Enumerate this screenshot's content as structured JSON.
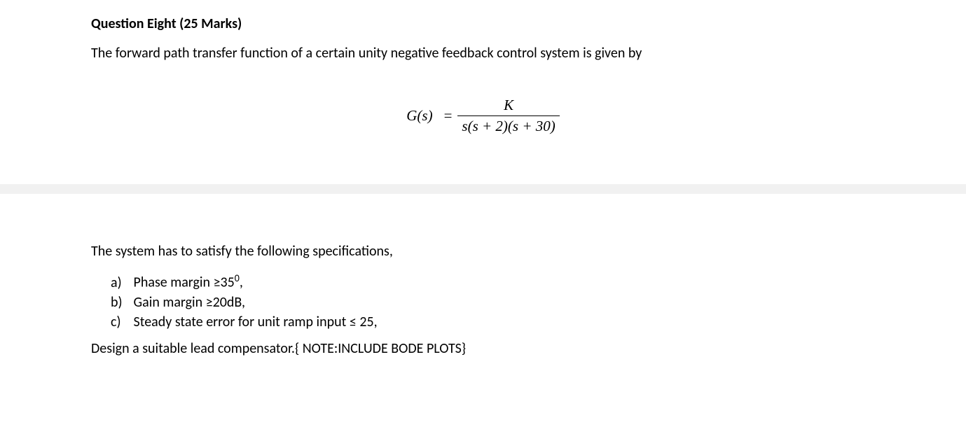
{
  "question": {
    "title": "Question Eight (25 Marks)",
    "intro": "The forward path transfer function of a certain unity negative feedback control system is given by",
    "equation": {
      "lhs": "G(s)",
      "eq": "=",
      "numerator": "K",
      "denominator": "s(s + 2)(s + 30)"
    },
    "spec_intro": "The system has to satisfy the following specifications,",
    "specs": [
      {
        "label": "a)",
        "text_pre": "Phase margin ≥35",
        "sup": "0",
        "text_post": ","
      },
      {
        "label": "b)",
        "text_pre": "Gain margin ≥20dB,",
        "sup": "",
        "text_post": ""
      },
      {
        "label": "c)",
        "text_pre": "Steady state error for unit ramp input ≤ 25,",
        "sup": "",
        "text_post": ""
      }
    ],
    "design": "Design a suitable lead compensator.{ NOTE:INCLUDE BODE PLOTS}"
  }
}
